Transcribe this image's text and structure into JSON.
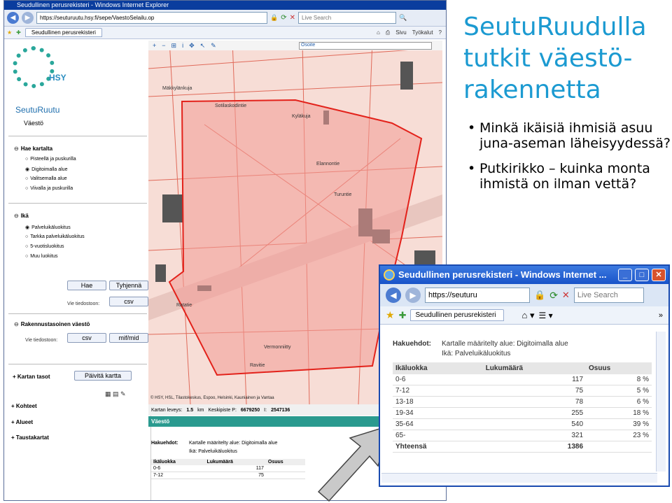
{
  "slide": {
    "title": "SeutuRuudulla tutkit väestö-rakennetta",
    "bullets": [
      "Minkä ikäisiä ihmisiä asuu juna-aseman läheisyydessä?",
      "Putkirikko – kuinka monta ihmistä on ilman vettä?"
    ]
  },
  "browser": {
    "title": "Seudullinen perusrekisteri - Windows Internet Explorer",
    "url": "https://seuturuutu.hsy.fi/sepe/VaestoSelailu.op",
    "search_placeholder": "Live Search",
    "tab_label": "Seudullinen perusrekisteri",
    "commands": [
      "Sivu",
      "Työkalut"
    ]
  },
  "sidebar": {
    "logo_text": "HSY",
    "app_title": "SeutuRuutu",
    "app_subtitle": "Väestö",
    "section_fetch": "Hae kartalta",
    "fetch_options": [
      "Pisteellä ja puskurilla",
      "Digitoimalla alue",
      "Valitsemalla alue",
      "Viivalla ja puskurilla"
    ],
    "section_age": "Ikä",
    "age_options": [
      "Palveluikäluokitus",
      "Tarkka palveluikäluokitus",
      "5-vuotisluokitus",
      "Muu luokitus"
    ],
    "btn_search": "Hae",
    "btn_clear": "Tyhjennä",
    "export_label": "Vie tiedostoon:",
    "btn_csv": "csv",
    "section_building": "Rakennustasoinen väestö",
    "export_label2": "Vie tiedostoon:",
    "btn_csv2": "csv",
    "btn_mifmid": "mif/mid",
    "layers_label": "Kartan tasot",
    "btn_update_map": "Päivitä kartta",
    "tree_items": [
      "Kohteet",
      "Alueet",
      "Taustakartat"
    ]
  },
  "map": {
    "address_label": "Osoite",
    "copyright": "© HSY, HSL, Tilastokeskus, Espoo, Helsinki, Kauniainen ja Vantaa",
    "street_labels": [
      "Turuntie",
      "Vermonniitty",
      "Ravitie",
      "Ratatie",
      "Elannontie",
      "Kyläkuja",
      "Sotilaskodintie",
      "Mäkkylänkuja"
    ],
    "status_width_label": "Kartan leveys:",
    "status_width_value": "1.5",
    "status_width_unit": "km",
    "status_center_label": "Keskipiste P:",
    "status_p": "6679250",
    "status_i_label": "I:",
    "status_i": "2547136"
  },
  "results": {
    "panel_title": "Väestö",
    "criteria_label": "Hakuehdot:",
    "criteria_line1": "Kartalle määritelty alue: Digitoimalla alue",
    "criteria_line2": "Ikä: Palveluikäluokitus",
    "columns": [
      "Ikäluokka",
      "Lukumäärä",
      "Osuus"
    ],
    "rows": [
      {
        "age": "0-6",
        "count": "117",
        "share": "8 %"
      },
      {
        "age": "7-12",
        "count": "75",
        "share": "5 %"
      },
      {
        "age": "13-18",
        "count": "78",
        "share": "6 %"
      },
      {
        "age": "19-34",
        "count": "255",
        "share": "18 %"
      },
      {
        "age": "35-64",
        "count": "540",
        "share": "39 %"
      },
      {
        "age": "65-",
        "count": "321",
        "share": "23 %"
      }
    ],
    "total_label": "Yhteensä",
    "total_count": "1386"
  },
  "popup": {
    "title": "Seudullinen perusrekisteri - Windows Internet ...",
    "url": "https://seuturu",
    "search_placeholder": "Live Search",
    "tab_label": "Seudullinen perusrekisteri"
  }
}
